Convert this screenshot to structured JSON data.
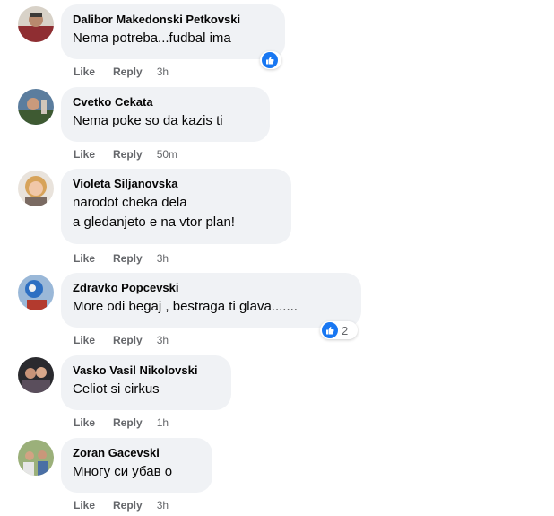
{
  "actions": {
    "like_label": "Like",
    "reply_label": "Reply"
  },
  "colors": {
    "bubble": "#f0f2f5",
    "meta": "#65676b",
    "like_blue": "#1877f2"
  },
  "comments": [
    {
      "author": "Dalibor Makedonski Petkovski",
      "text": "Nema potreba...fudbal ima",
      "time": "3h",
      "reaction": "like-icon",
      "reaction_count": ""
    },
    {
      "author": "Cvetko Cekata",
      "text": "Nema poke so da kazis ti",
      "time": "50m"
    },
    {
      "author": "Violeta Siljanovska",
      "text": "narodot cheka dela\na gledanjeto e na vtor plan!",
      "time": "3h"
    },
    {
      "author": "Zdravko Popcevski",
      "text": "More odi begaj , bestraga ti glava.......",
      "time": "3h",
      "reaction": "like-icon",
      "reaction_count": "2"
    },
    {
      "author": "Vasko Vasil Nikolovski",
      "text": "Celiot si cirkus",
      "time": "1h"
    },
    {
      "author": "Zoran Gacevski",
      "text": "Многу си убав о",
      "time": "3h"
    }
  ]
}
